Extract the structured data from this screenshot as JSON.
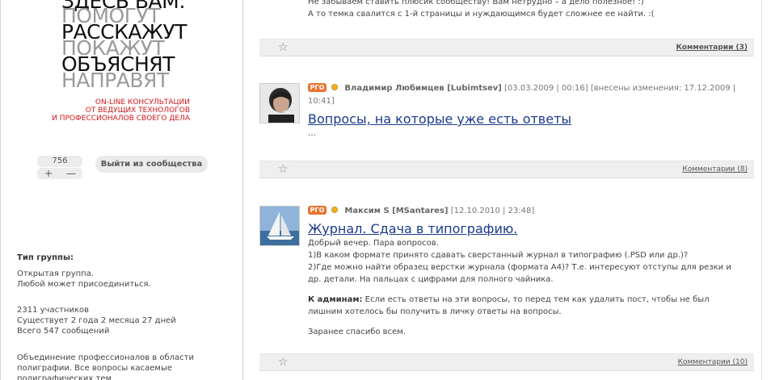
{
  "sidebar": {
    "promo_lines": [
      "ЗДЕСЬ ВАМ:",
      "ПОМОГУТ",
      "РАССКАЖУТ",
      "ПОКАЖУТ",
      "ОБЪЯСНЯТ",
      "НАПРАВЯТ"
    ],
    "promo_sub": [
      "ON-LINE КОНСУЛЬТАЦИИ",
      "ОТ ВЕДУЩИХ ТЕХНОЛОГОВ",
      "И ПРОФЕССИОНАЛОВ СВОЕГО ДЕЛА"
    ],
    "rating": "756",
    "plus_label": "+",
    "minus_label": "—",
    "leave_button": "Выйти из сообщества",
    "group_type_heading": "Тип группы:",
    "group_type_lines": [
      "Открытая группа.",
      "Любой может присоединиться."
    ],
    "stats": [
      "2311 участников",
      "Существует 2 года 2 месяца 27 дней",
      "Всего 547 сообщений"
    ],
    "description": [
      "Объединение профессионалов в области",
      "полиграфии. Все вопросы касаемые",
      "полиграфических тем"
    ]
  },
  "posts": [
    {
      "text_lines": [
        "Не забываем ставить плюсик сообществу! Вам нетрудно –  а дело полезное! :)",
        "А то темка свалится с 1-й страницы и нуждающимся будет сложнее ее найти. :("
      ],
      "comments": "Комментарии (3)"
    },
    {
      "badge": "PГO",
      "author": "Владимир Любимцев [Lubimtsev]",
      "date": "[03.03.2009 | 00:16]",
      "edited": "[внесены изменения: 17.12.2009 |",
      "edited_time": "10:41]",
      "title": "Вопросы, на которые уже есть ответы",
      "excerpt": "…",
      "comments": "Комментарии (8)"
    },
    {
      "badge": "PГO",
      "author": "Максим S [MSantares]",
      "date": "[12.10.2010 | 23:48]",
      "title": "Журнал. Сдача в типографию.",
      "text_lines": [
        "Добрый вечер. Пара вопросов.",
        "1)В каком формате принято сдавать сверстанный журнал в типографию (.PSD или др.)?",
        "2)Где можно найти образец верстки журнала (формата А4)? Т.е. интересуют отступы для резки и",
        "др. детали. На пальцах с цифрами для полного чайника."
      ],
      "admin_label": "К админам:",
      "admin_text": " Если есть ответы на эти вопросы, то перед тем как удалить пост, чтобы не был",
      "admin_text2": "лишним хотелось бы получить в личку ответы на вопросы.",
      "thanks": "Заранее спасибо всем.",
      "comments": "Комментарии (10)"
    }
  ],
  "icons": {
    "favorite": "star-icon",
    "online": "online-status-icon",
    "pro": "pro-badge"
  }
}
